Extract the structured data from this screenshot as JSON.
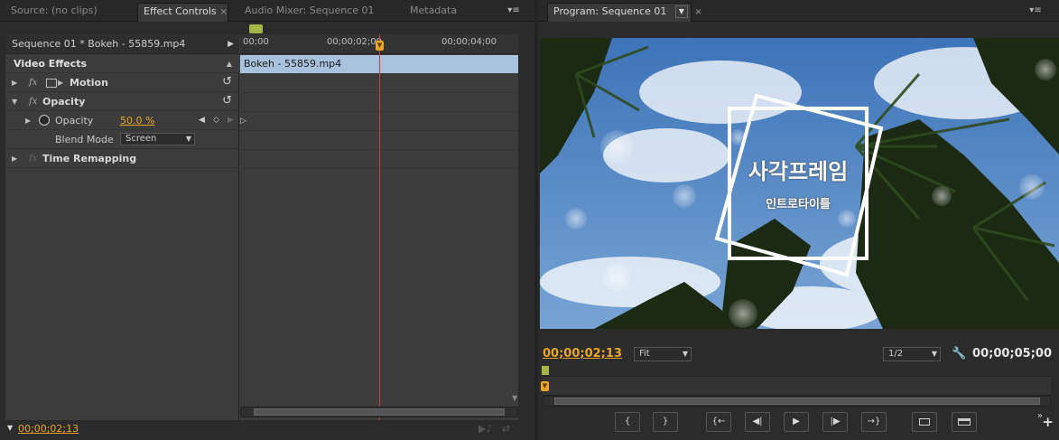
{
  "left_tabs": [
    {
      "label": "Source: (no clips)",
      "active": false,
      "closable": false
    },
    {
      "label": "Effect Controls",
      "active": true,
      "closable": true
    },
    {
      "label": "Audio Mixer: Sequence 01",
      "active": false,
      "closable": false
    },
    {
      "label": "Metadata",
      "active": false,
      "closable": false
    }
  ],
  "effect_controls": {
    "sequence_label": "Sequence 01 * Bokeh - 55859.mp4",
    "video_effects_label": "Video Effects",
    "motion_label": "Motion",
    "opacity_label": "Opacity",
    "opacity_param_label": "Opacity",
    "opacity_value": "50.0 %",
    "blend_mode_label": "Blend Mode",
    "blend_mode_value": "Screen",
    "time_remapping_label": "Time Remapping",
    "fx_symbol": "fx",
    "ruler_labels": [
      "00;00",
      "00;00;02;00",
      "00;00;04;00"
    ],
    "clip_name": "Bokeh - 55859.mp4",
    "footer_timecode": "00;00;02;13"
  },
  "program_monitor": {
    "tab_label": "Program: Sequence 01",
    "title_overlay": "사각프레임",
    "subtitle_overlay": "인트로타이틀",
    "current_time": "00;00;02;13",
    "fit_value": "Fit",
    "resolution_value": "1/2",
    "duration": "00;00;05;00",
    "transport_buttons": [
      "{",
      "}",
      "{←",
      "◀|",
      "▶",
      "|▶",
      "→}",
      "lift",
      "extract"
    ]
  },
  "colors": {
    "accent_timecode": "#e8a628",
    "clip_bar": "#a8c1dc",
    "playhead": "#d23b3b",
    "sky": "#4d83c6"
  }
}
